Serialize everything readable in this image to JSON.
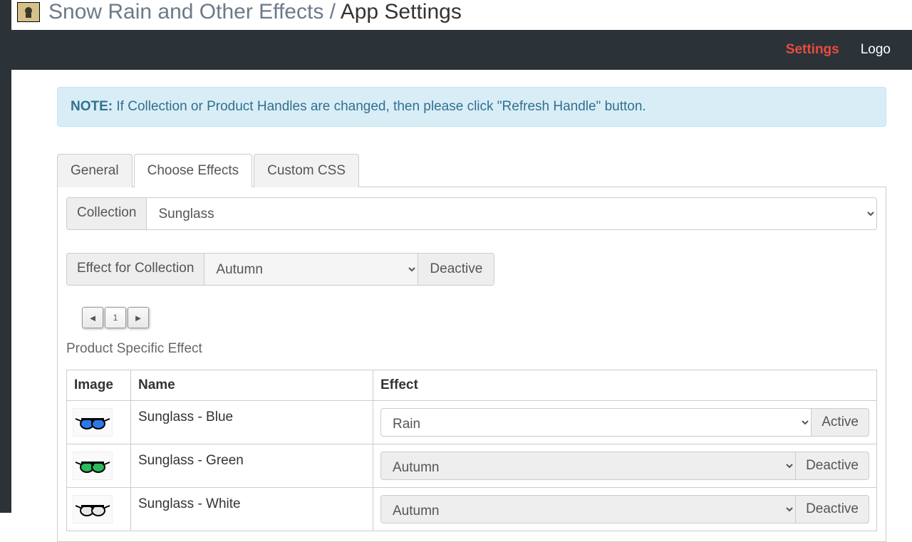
{
  "breadcrumb": {
    "parent": "Snow Rain and Other Effects",
    "sep": "/",
    "current": "App Settings"
  },
  "nav": {
    "settings": "Settings",
    "logout": "Logo"
  },
  "alert": {
    "label": "NOTE:",
    "text": " If Collection or Product Handles are changed, then please click \"Refresh Handle\" button."
  },
  "tabs": {
    "general": "General",
    "choose": "Choose Effects",
    "css": "Custom CSS"
  },
  "collection": {
    "label": "Collection",
    "value": "Sunglass"
  },
  "effectFor": {
    "label": "Effect for Collection",
    "value": "Autumn",
    "btn": "Deactive"
  },
  "pager": {
    "prev": "◄",
    "page": "1",
    "next": "►"
  },
  "sectionTitle": "Product Specific Effect",
  "table": {
    "headers": {
      "image": "Image",
      "name": "Name",
      "effect": "Effect"
    },
    "rows": [
      {
        "name": "Sunglass - Blue",
        "effect": "Rain",
        "btn": "Active",
        "color": "#2b7ae8",
        "bg": "white"
      },
      {
        "name": "Sunglass - Green",
        "effect": "Autumn",
        "btn": "Deactive",
        "color": "#2db85a",
        "bg": "gray"
      },
      {
        "name": "Sunglass - White",
        "effect": "Autumn",
        "btn": "Deactive",
        "color": "#e8e8e8",
        "bg": "gray"
      }
    ]
  }
}
